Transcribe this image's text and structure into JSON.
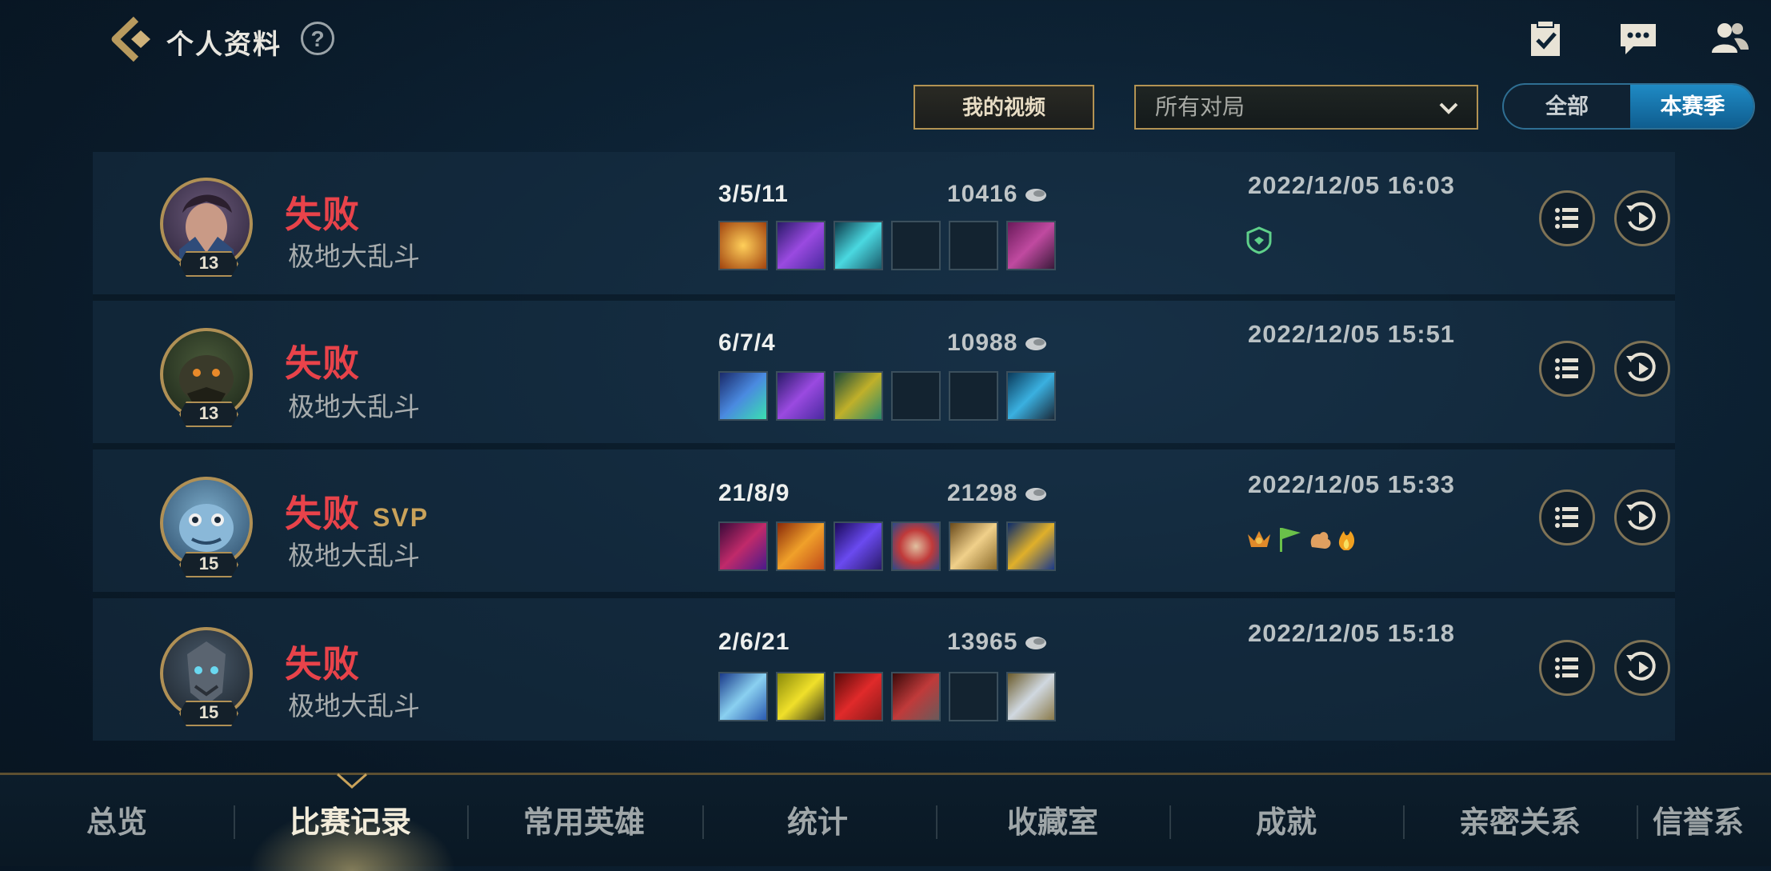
{
  "header": {
    "title": "个人资料",
    "help_label": "?"
  },
  "filters": {
    "video_button": "我的视频",
    "game_filter": "所有对局",
    "toggle_all": "全部",
    "toggle_season": "本赛季"
  },
  "matches": [
    {
      "result": "失败",
      "svp": "",
      "mode": "极地大乱斗",
      "level": "13",
      "kda": "3/5/11",
      "gold": "10416",
      "timestamp": "2022/12/05 16:03"
    },
    {
      "result": "失败",
      "svp": "",
      "mode": "极地大乱斗",
      "level": "13",
      "kda": "6/7/4",
      "gold": "10988",
      "timestamp": "2022/12/05 15:51"
    },
    {
      "result": "失败",
      "svp": "SVP",
      "mode": "极地大乱斗",
      "level": "15",
      "kda": "21/8/9",
      "gold": "21298",
      "timestamp": "2022/12/05 15:33"
    },
    {
      "result": "失败",
      "svp": "",
      "mode": "极地大乱斗",
      "level": "15",
      "kda": "2/6/21",
      "gold": "13965",
      "timestamp": "2022/12/05 15:18"
    }
  ],
  "nav": {
    "tabs": [
      "总览",
      "比赛记录",
      "常用英雄",
      "统计",
      "收藏室",
      "成就",
      "亲密关系",
      "信誉系"
    ],
    "active": "比赛记录"
  },
  "colors": {
    "loss_red": "#e8434a",
    "gold_accent": "#b39353",
    "active_blue": "#1f8ac4"
  },
  "icons": [
    "back-icon",
    "help-icon",
    "tasks-icon",
    "chat-icon",
    "friends-icon",
    "chevron-down-icon",
    "gold-coin-icon",
    "details-list-icon",
    "replay-icon"
  ]
}
